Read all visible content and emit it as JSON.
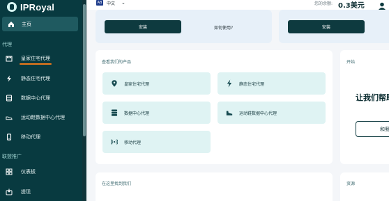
{
  "app": {
    "name": "IPRoyal"
  },
  "sidebar": {
    "home_label": "主页",
    "section_proxy": "代理",
    "items": [
      {
        "label": "皇家住宅代理",
        "icon": "castle-icon"
      },
      {
        "label": "静态住宅代理",
        "icon": "bolt-icon"
      },
      {
        "label": "数据中心代理",
        "icon": "server-icon"
      },
      {
        "label": "运动鞋数据中心代理",
        "icon": "sneaker-icon"
      },
      {
        "label": "移动代理",
        "icon": "mobile-icon"
      }
    ],
    "section_affiliate": "联盟推广",
    "affiliate_items": [
      {
        "label": "仪表板",
        "icon": "dashboard-icon"
      },
      {
        "label": "提现",
        "icon": "withdraw-icon"
      }
    ]
  },
  "topbar": {
    "flag_text": "AB",
    "language": "中文",
    "balance_label": "您的余额:",
    "balance_value": "0.3美元"
  },
  "top_cards": {
    "install_label": "安装",
    "how_to_use": "如何使用?",
    "install_label_2": "安装"
  },
  "products_panel": {
    "title": "查看我们的产品",
    "items": [
      {
        "label": "皇家住宅代理",
        "icon": "map-pin-icon"
      },
      {
        "label": "静态住宅代理",
        "icon": "bolt-icon"
      },
      {
        "label": "数据中心代理",
        "icon": "database-icon"
      },
      {
        "label": "运动鞋数据中心代理",
        "icon": "sneaker-icon"
      },
      {
        "label": "移动代理",
        "icon": "signal-icon"
      }
    ]
  },
  "start_panel": {
    "title": "开始",
    "heading": "让我们帮助",
    "button_label": "和我"
  },
  "bottom": {
    "find_label": "在这里找到我们",
    "resources_label": "资源"
  },
  "colors": {
    "sidebar_bg": "#083a40",
    "accent_underline": "#f07a18",
    "primary_button": "#0e3a3f",
    "product_card_bg": "#dff3f3"
  }
}
